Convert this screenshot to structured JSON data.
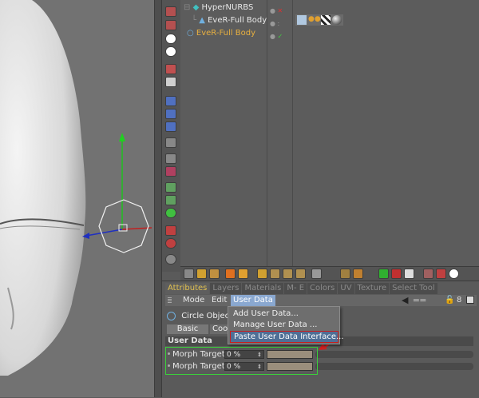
{
  "object_manager": {
    "objects": [
      {
        "name": "HyperNURBS",
        "color": "#e8e8e8"
      },
      {
        "name": "EveR-Full Body",
        "color": "#e8e8e8"
      },
      {
        "name": "EveR-Full Body",
        "color": "#e8b040"
      }
    ]
  },
  "attributes": {
    "tabs": [
      "Attributes",
      "Layers",
      "Materials",
      "M- E",
      "Colors",
      "UV",
      "Texture",
      "Select Tool"
    ],
    "menu": [
      "Mode",
      "Edit",
      "User Data"
    ],
    "object_label": "Circle Object",
    "sub_tabs": [
      "Basic",
      "Coo"
    ],
    "section_title": "User Data",
    "morph_targets": [
      {
        "label": "Morph Target",
        "value": "0 %"
      },
      {
        "label": "Morph Target",
        "value": "0 %"
      }
    ]
  },
  "dropdown": {
    "items": [
      "Add User Data...",
      "Manage User Data ...",
      "Paste User Data Interface..."
    ],
    "highlighted_index": 2
  },
  "colors": {
    "active_tab": "#e0c050",
    "selected_object": "#e8b040",
    "highlight_border": "#c81e1e",
    "frame": "#3ad03a"
  }
}
